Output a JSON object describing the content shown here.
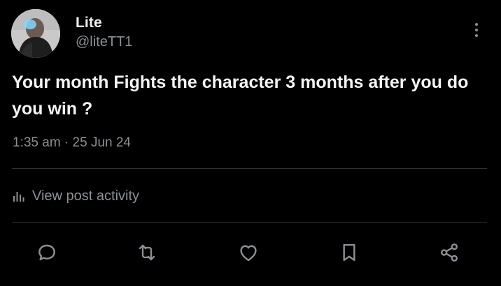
{
  "author": {
    "display_name": "Lite",
    "handle": "@liteTT1"
  },
  "post": {
    "text": "Your month Fights the character 3 months after you do you win ?",
    "timestamp": "1:35 am · 25 Jun 24"
  },
  "activity": {
    "label": "View post activity",
    "icon": "bar-chart-icon"
  },
  "actions": [
    {
      "name": "reply",
      "icon": "reply-icon"
    },
    {
      "name": "repost",
      "icon": "repost-icon"
    },
    {
      "name": "like",
      "icon": "heart-icon"
    },
    {
      "name": "bookmark",
      "icon": "bookmark-icon"
    },
    {
      "name": "share",
      "icon": "share-icon"
    }
  ],
  "colors": {
    "background": "#000000",
    "text_primary": "#f4f4f4",
    "text_secondary": "#8b9096",
    "divider": "#2f3336"
  }
}
